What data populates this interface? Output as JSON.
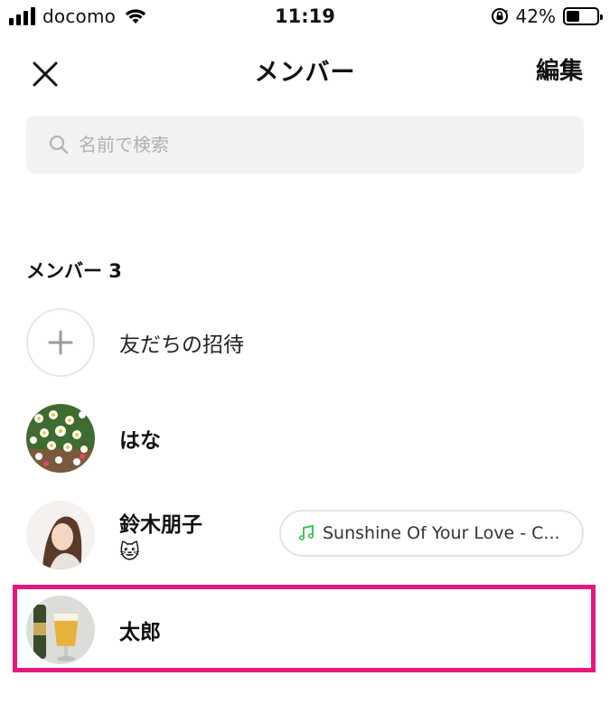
{
  "status_bar": {
    "carrier": "docomo",
    "time": "11:19",
    "battery_percent": "42%",
    "battery_level": 0.42,
    "signal_bars": 4
  },
  "header": {
    "title": "メンバー",
    "edit_label": "編集",
    "close_icon": "close-icon"
  },
  "search": {
    "placeholder": "名前で検索"
  },
  "section": {
    "title": "メンバー 3"
  },
  "invite": {
    "label": "友だちの招待"
  },
  "members": [
    {
      "name": "はな"
    },
    {
      "name": "鈴木朋子",
      "status": "🐱",
      "music": "Sunshine Of Your Love - C..."
    },
    {
      "name": "太郎"
    }
  ],
  "colors": {
    "accent_highlight": "#e5197c",
    "music_icon": "#2fbf4a",
    "search_bg": "#f2f2f3"
  }
}
